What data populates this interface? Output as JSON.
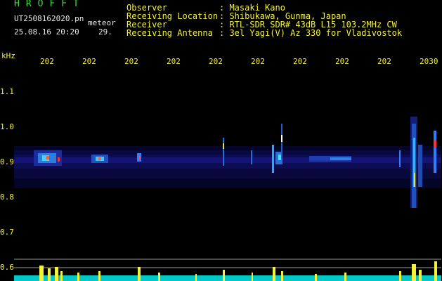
{
  "header": {
    "brand": "HROFFT",
    "filename": "UT2508162020.pn",
    "type": "meteor",
    "datetime": "25.08.16 20:20",
    "seconds": "29."
  },
  "info": {
    "observer_label": "Observer",
    "observer_value": ": Masaki Kano",
    "location_label": "Receiving Location",
    "location_value": ": Shibukawa, Gunma, Japan",
    "receiver_label": "Receiver",
    "receiver_value": ": RTL-SDR SDR# 43dB L15 103.2MHz CW",
    "antenna_label": "Receiving Antenna",
    "antenna_value": ": 3el Yagi(V) Az 330 for Vladivostok"
  },
  "axis": {
    "unit": "kHz",
    "y_ticks": [
      "1.1",
      "1.0",
      "0.9",
      "0.8",
      "0.7",
      "0.6"
    ],
    "x_ticks": [
      "202",
      "202",
      "202",
      "202",
      "202",
      "202",
      "202",
      "202",
      "202",
      "2030"
    ]
  },
  "colors": {
    "label_green": "#3fdc3f",
    "label_yellow": "#f2f23a",
    "label_white": "#e8e8e8",
    "background": "#000000"
  }
}
